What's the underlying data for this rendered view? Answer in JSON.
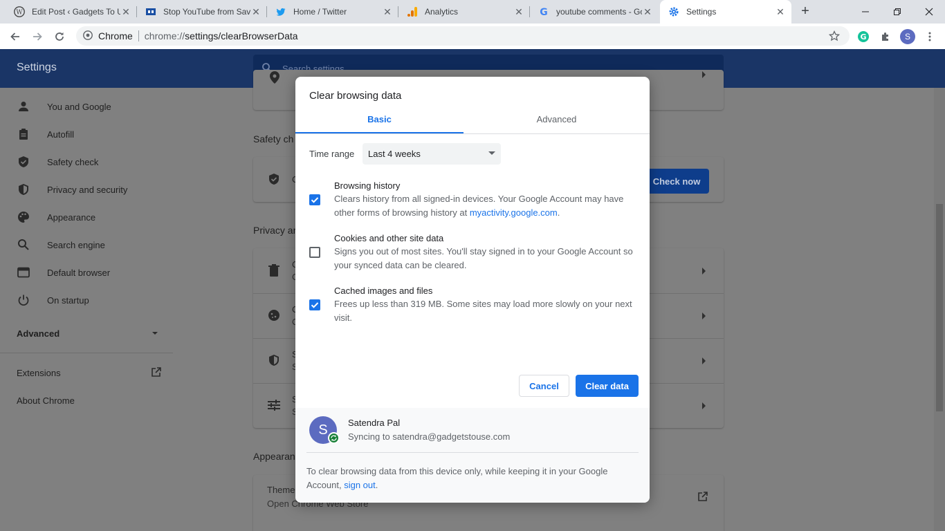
{
  "browser": {
    "tabs": [
      {
        "title": "Edit Post ‹ Gadgets To Use",
        "icon": "wordpress-icon"
      },
      {
        "title": "Stop YouTube from Saving",
        "icon": "gadgets-to-use-icon"
      },
      {
        "title": "Home / Twitter",
        "icon": "twitter-icon"
      },
      {
        "title": "Analytics",
        "icon": "analytics-icon"
      },
      {
        "title": "youtube comments - Google",
        "icon": "google-icon"
      },
      {
        "title": "Settings",
        "icon": "settings-gear-icon"
      }
    ],
    "omnibox": {
      "site_chip": "Chrome",
      "url_scheme": "chrome://",
      "url_path": "settings/clearBrowserData"
    },
    "profile_initial": "S"
  },
  "settings": {
    "title": "Settings",
    "search_placeholder": "Search settings",
    "nav": [
      {
        "label": "You and Google",
        "icon": "person-icon"
      },
      {
        "label": "Autofill",
        "icon": "clipboard-icon"
      },
      {
        "label": "Safety check",
        "icon": "shield-check-icon"
      },
      {
        "label": "Privacy and security",
        "icon": "shield-icon"
      },
      {
        "label": "Appearance",
        "icon": "palette-icon"
      },
      {
        "label": "Search engine",
        "icon": "search-icon"
      },
      {
        "label": "Default browser",
        "icon": "browser-window-icon"
      },
      {
        "label": "On startup",
        "icon": "power-icon"
      }
    ],
    "advanced_label": "Advanced",
    "extensions_label": "Extensions",
    "about_label": "About Chrome",
    "sections": {
      "safety": "Safety ch",
      "privacy": "Privacy ar",
      "appearance": "Appearan"
    },
    "check_now": "Check now",
    "rows": {
      "safety_row": "C",
      "privacy_row1": "C",
      "privacy_row1_sub": "C",
      "privacy_row2": "C",
      "privacy_row2_sub": "C",
      "privacy_row3": "S",
      "privacy_row3_sub": "S",
      "privacy_row4": "S",
      "privacy_row4_sub": "S",
      "themes": "Theme",
      "themes_sub": "Open Chrome Web Store"
    }
  },
  "dialog": {
    "title": "Clear browsing data",
    "tabs": {
      "basic": "Basic",
      "advanced": "Advanced"
    },
    "time_range_label": "Time range",
    "time_range_value": "Last 4 weeks",
    "options": [
      {
        "title": "Browsing history",
        "desc_before_link": "Clears history from all signed-in devices. Your Google Account may have other forms of browsing history at ",
        "link": "myactivity.google.com",
        "desc_after_link": ".",
        "checked": true
      },
      {
        "title": "Cookies and other site data",
        "desc": "Signs you out of most sites. You'll stay signed in to your Google Account so your synced data can be cleared.",
        "checked": false
      },
      {
        "title": "Cached images and files",
        "desc": "Frees up less than 319 MB. Some sites may load more slowly on your next visit.",
        "checked": true
      }
    ],
    "cancel": "Cancel",
    "clear": "Clear data",
    "account": {
      "initial": "S",
      "name": "Satendra Pal",
      "sync": "Syncing to satendra@gadgetstouse.com"
    },
    "footer_note": "To clear browsing data from this device only, while keeping it in your Google Account, ",
    "footer_link": "sign out",
    "footer_end": "."
  },
  "colors": {
    "accent": "#1a73e8",
    "header_dimmed": "#1a3566",
    "avatar": "#5c6bc0",
    "sync_badge": "#188038"
  }
}
